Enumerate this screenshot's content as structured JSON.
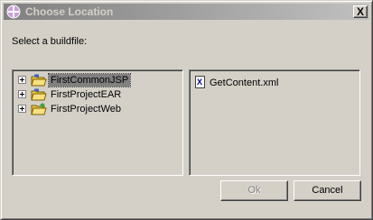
{
  "window": {
    "title": "Choose Location",
    "title_icon": "eclipse-icon",
    "close_label": "X"
  },
  "prompt": "Select a buildfile:",
  "tree": {
    "items": [
      {
        "label": "FirstCommonJSP",
        "icon": "project-folder-icon",
        "selected": true
      },
      {
        "label": "FirstProjectEAR",
        "icon": "project-folder-icon",
        "selected": false
      },
      {
        "label": "FirstProjectWeb",
        "icon": "project-folder-icon",
        "selected": false
      }
    ]
  },
  "files": {
    "items": [
      {
        "label": "GetContent.xml",
        "icon": "xml-file-icon",
        "icon_glyph": "X"
      }
    ]
  },
  "buttons": {
    "ok_label": "Ok",
    "ok_enabled": false,
    "cancel_label": "Cancel"
  },
  "colors": {
    "face": "#d4d0c8",
    "title_gradient_start": "#808080",
    "title_gradient_end": "#c0c0c0",
    "selection": "#808080",
    "folder": "#e8c848"
  }
}
